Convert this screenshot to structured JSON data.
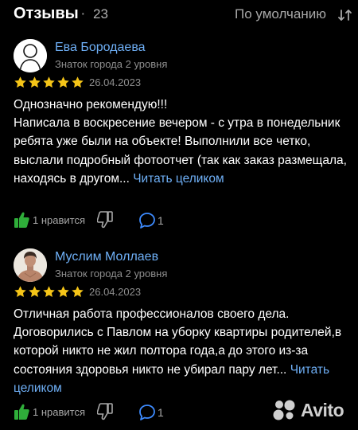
{
  "header": {
    "title": "Отзывы",
    "separator": "·",
    "count": "23",
    "sort_label": "По умолчанию",
    "sort_icon": "sort-icon"
  },
  "reviews": [
    {
      "author": "Ева Бородаева",
      "level": "Знаток города 2 уровня",
      "rating": 5,
      "date": "26.04.2023",
      "text": "Однозначно рекомендую!!!\nНаписала в воскресение вечером - с утра в понедельник ребята уже были на объекте! Выполнили все четко, выслали подробный фотоотчет (так как заказ размещала, находясь в другом...",
      "read_more": "Читать целиком",
      "like_label": "1 нравится",
      "comment_count": "1"
    },
    {
      "author": "Муслим Моллаев",
      "level": "Знаток города 2 уровня",
      "rating": 5,
      "date": "26.04.2023",
      "text": "Отличная работа профессионалов своего дела. Договорились с Павлом на уборку квартиры родителей,в которой никто не жил полтора года,а до этого из-за состояния здоровья никто не убирал пару лет...",
      "read_more": "Читать целиком",
      "like_label": "1 нравится",
      "comment_count": "1"
    }
  ],
  "watermark": {
    "text": "Avito"
  },
  "colors": {
    "background": "#000000",
    "link": "#6fb0f7",
    "star": "#f5c518",
    "like": "#2fae3a",
    "comment": "#3d8bff",
    "muted": "#8e8e8e"
  }
}
